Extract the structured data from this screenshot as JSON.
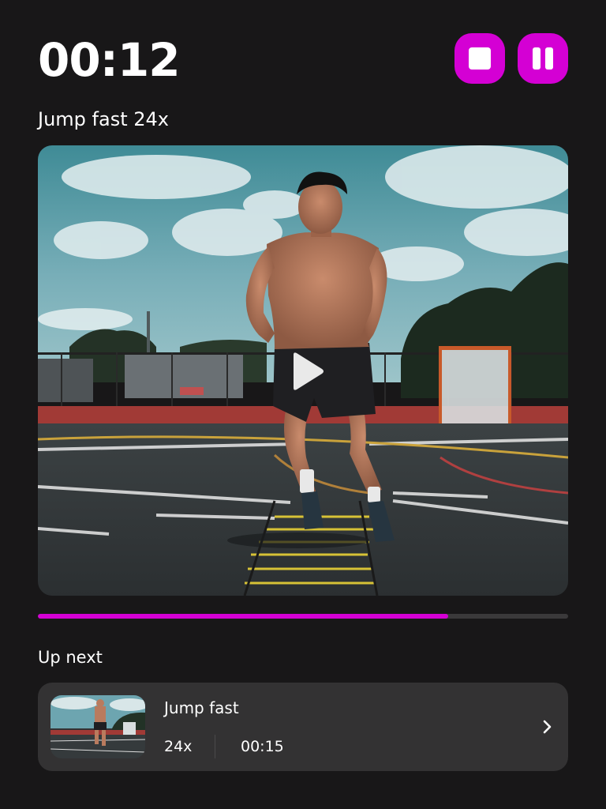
{
  "header": {
    "timer": "00:12",
    "stop_icon": "stop-icon",
    "pause_icon": "pause-icon"
  },
  "exercise": {
    "title": "Jump fast 24x"
  },
  "video": {
    "play_icon": "play-icon",
    "progress_fraction": 0.774
  },
  "up_next": {
    "label": "Up next",
    "item": {
      "title": "Jump fast",
      "reps": "24x",
      "duration": "00:15",
      "chevron_icon": "chevron-right-icon"
    }
  },
  "colors": {
    "background": "#181718",
    "accent": "#d400d4",
    "card": "#333233",
    "track": "#3a393a"
  }
}
